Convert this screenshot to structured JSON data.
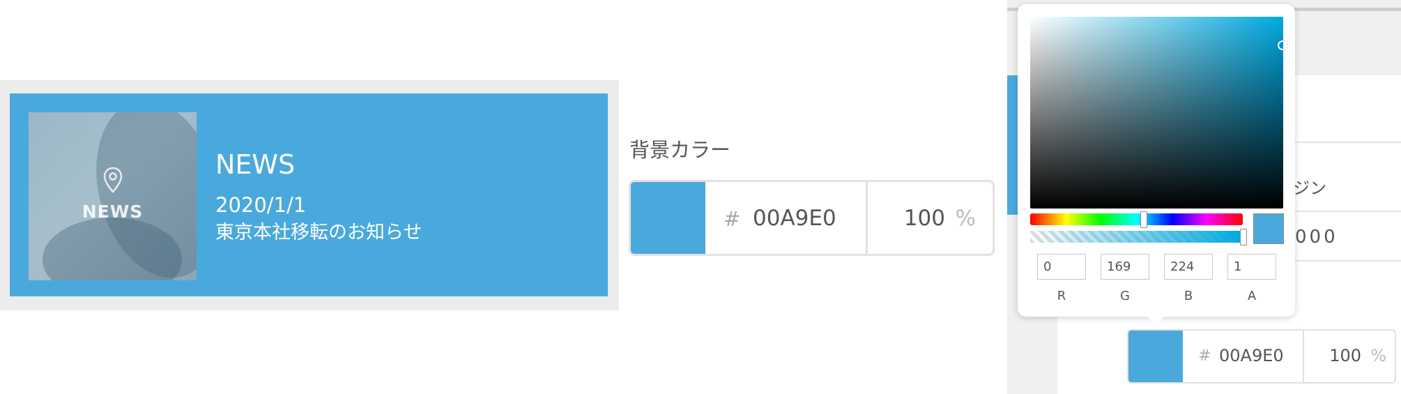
{
  "news_card": {
    "thumbnail_label": "NEWS",
    "title": "NEWS",
    "date": "2020/1/1",
    "headline": "東京本社移転のお知らせ",
    "background_color": "#4aa9dc"
  },
  "background_color_setting": {
    "label": "背景カラー",
    "hash": "#",
    "hex_value": "00A9E0",
    "opacity_value": "100",
    "opacity_unit": "%"
  },
  "settings_panel": {
    "partial_label": "ジン",
    "partial_value": "000"
  },
  "color_picker": {
    "hue_position": 0.53,
    "alpha_position": 1.0,
    "channels": [
      {
        "label": "R",
        "value": "0"
      },
      {
        "label": "G",
        "value": "169"
      },
      {
        "label": "B",
        "value": "224"
      },
      {
        "label": "A",
        "value": "1"
      }
    ]
  },
  "bottom_color_field": {
    "hash": "#",
    "hex_value": "00A9E0",
    "opacity_value": "100",
    "opacity_unit": "%"
  },
  "colors": {
    "accent": "#4aa9dc",
    "panel_bg": "#f0f0f0",
    "card_frame": "#ececec"
  }
}
